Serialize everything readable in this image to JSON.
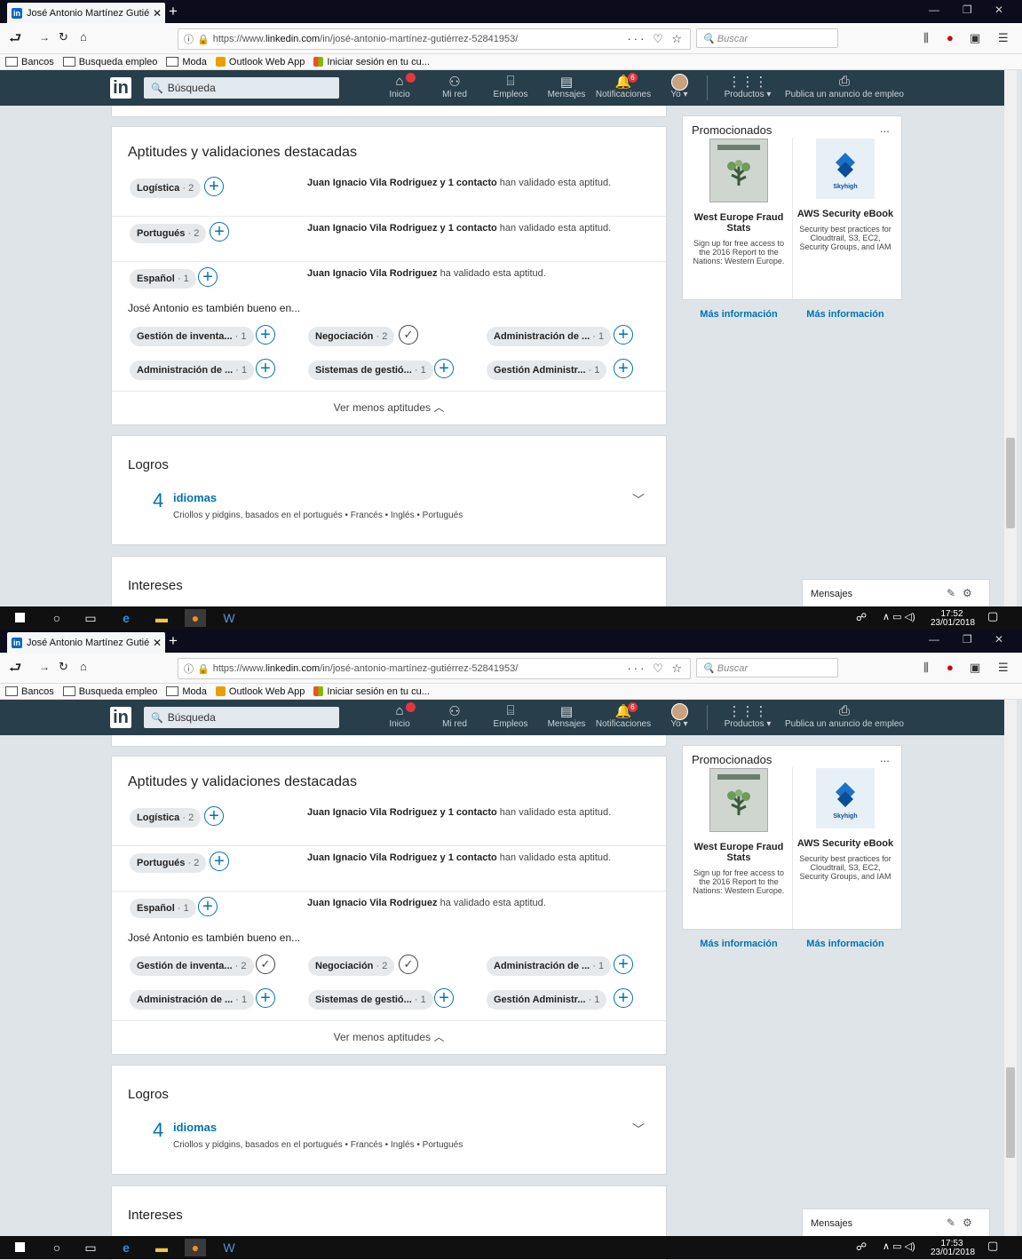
{
  "screens": [
    {
      "browser": {
        "tab_title": "José Antonio Martínez Gutiérrez",
        "url_prefix": "https://www.",
        "url_domain": "linkedin.com",
        "url_path": "/in/josé-antonio-martínez-gutiérrez-52841953/",
        "search_placeholder": "Buscar",
        "bookmarks": [
          "Bancos",
          "Busqueda empleo",
          "Moda",
          "Outlook Web App",
          "Iniciar sesión en tu cu..."
        ]
      },
      "linkedin_nav": {
        "search_placeholder": "Búsqueda",
        "items": [
          "Inicio",
          "Mi red",
          "Empleos",
          "Mensajes",
          "Notificaciones",
          "Yo",
          "Productos",
          "Publica un anuncio de empleo"
        ],
        "notification_count": "6"
      },
      "skills": {
        "title": "Aptitudes y validaciones destacadas",
        "top": [
          {
            "name": "Logística",
            "count": "2",
            "endorser": "Juan Ignacio Vila Rodriguez y 1 contacto",
            "text": "han validado esta aptitud."
          },
          {
            "name": "Portugués",
            "count": "2",
            "endorser": "Juan Ignacio Vila Rodriguez y 1 contacto",
            "text": "han validado esta aptitud."
          },
          {
            "name": "Español",
            "count": "1",
            "endorser": "Juan Ignacio Vila Rodriguez",
            "text": "ha validado esta aptitud."
          }
        ],
        "also_good": "José Antonio es también bueno en...",
        "others": [
          {
            "name": "Gestión de inventa...",
            "count": "1",
            "endorsed": false
          },
          {
            "name": "Negociación",
            "count": "2",
            "endorsed": true
          },
          {
            "name": "Administración de ...",
            "count": "1",
            "endorsed": false
          },
          {
            "name": "Administración de ...",
            "count": "1",
            "endorsed": false
          },
          {
            "name": "Sistemas de gestió...",
            "count": "1",
            "endorsed": false
          },
          {
            "name": "Gestión Administr...",
            "count": "1",
            "endorsed": false
          }
        ],
        "toggle": "Ver menos aptitudes"
      },
      "logros": {
        "title": "Logros",
        "count": "4",
        "label": "idiomas",
        "languages": "Criollos y pidgins, basados en el portugués • Francés • Inglés • Portugués"
      },
      "intereses": {
        "title": "Intereses"
      },
      "promo": {
        "title": "Promocionados",
        "ads": [
          {
            "headline": "West Europe Fraud Stats",
            "body": "Sign up for free access to the 2016 Report to the Nations: Western Europe.",
            "cta": "Más información"
          },
          {
            "headline": "AWS Security eBook",
            "body": "Security best practices for Cloudtrail, S3, EC2, Security Groups, and IAM",
            "cta": "Más información",
            "brand": "Skyhigh"
          }
        ]
      },
      "messages": {
        "label": "Mensajes"
      },
      "clock": {
        "time": "17:52",
        "date": "23/01/2018"
      }
    },
    {
      "browser": {
        "tab_title": "José Antonio Martínez Gutiérrez",
        "url_prefix": "https://www.",
        "url_domain": "linkedin.com",
        "url_path": "/in/josé-antonio-martínez-gutiérrez-52841953/",
        "search_placeholder": "Buscar",
        "bookmarks": [
          "Bancos",
          "Busqueda empleo",
          "Moda",
          "Outlook Web App",
          "Iniciar sesión en tu cu..."
        ]
      },
      "linkedin_nav": {
        "search_placeholder": "Búsqueda",
        "items": [
          "Inicio",
          "Mi red",
          "Empleos",
          "Mensajes",
          "Notificaciones",
          "Yo",
          "Productos",
          "Publica un anuncio de empleo"
        ],
        "notification_count": "6"
      },
      "skills": {
        "title": "Aptitudes y validaciones destacadas",
        "top": [
          {
            "name": "Logística",
            "count": "2",
            "endorser": "Juan Ignacio Vila Rodriguez y 1 contacto",
            "text": "han validado esta aptitud."
          },
          {
            "name": "Portugués",
            "count": "2",
            "endorser": "Juan Ignacio Vila Rodriguez y 1 contacto",
            "text": "han validado esta aptitud."
          },
          {
            "name": "Español",
            "count": "1",
            "endorser": "Juan Ignacio Vila Rodriguez",
            "text": "ha validado esta aptitud."
          }
        ],
        "also_good": "José Antonio es también bueno en...",
        "others": [
          {
            "name": "Gestión de inventa...",
            "count": "2",
            "endorsed": true
          },
          {
            "name": "Negociación",
            "count": "2",
            "endorsed": true
          },
          {
            "name": "Administración de ...",
            "count": "1",
            "endorsed": false
          },
          {
            "name": "Administración de ...",
            "count": "1",
            "endorsed": false
          },
          {
            "name": "Sistemas de gestió...",
            "count": "1",
            "endorsed": false
          },
          {
            "name": "Gestión Administr...",
            "count": "1",
            "endorsed": false
          }
        ],
        "toggle": "Ver menos aptitudes"
      },
      "logros": {
        "title": "Logros",
        "count": "4",
        "label": "idiomas",
        "languages": "Criollos y pidgins, basados en el portugués • Francés • Inglés • Portugués"
      },
      "intereses": {
        "title": "Intereses"
      },
      "promo": {
        "title": "Promocionados",
        "ads": [
          {
            "headline": "West Europe Fraud Stats",
            "body": "Sign up for free access to the 2016 Report to the Nations: Western Europe.",
            "cta": "Más información"
          },
          {
            "headline": "AWS Security eBook",
            "body": "Security best practices for Cloudtrail, S3, EC2, Security Groups, and IAM",
            "cta": "Más información",
            "brand": "Skyhigh"
          }
        ]
      },
      "messages": {
        "label": "Mensajes"
      },
      "clock": {
        "time": "17:53",
        "date": "23/01/2018"
      }
    }
  ],
  "colors": {
    "linkedin_header": "#283e4a",
    "link_blue": "#0073b1",
    "page_bg": "#dfe4e8"
  }
}
